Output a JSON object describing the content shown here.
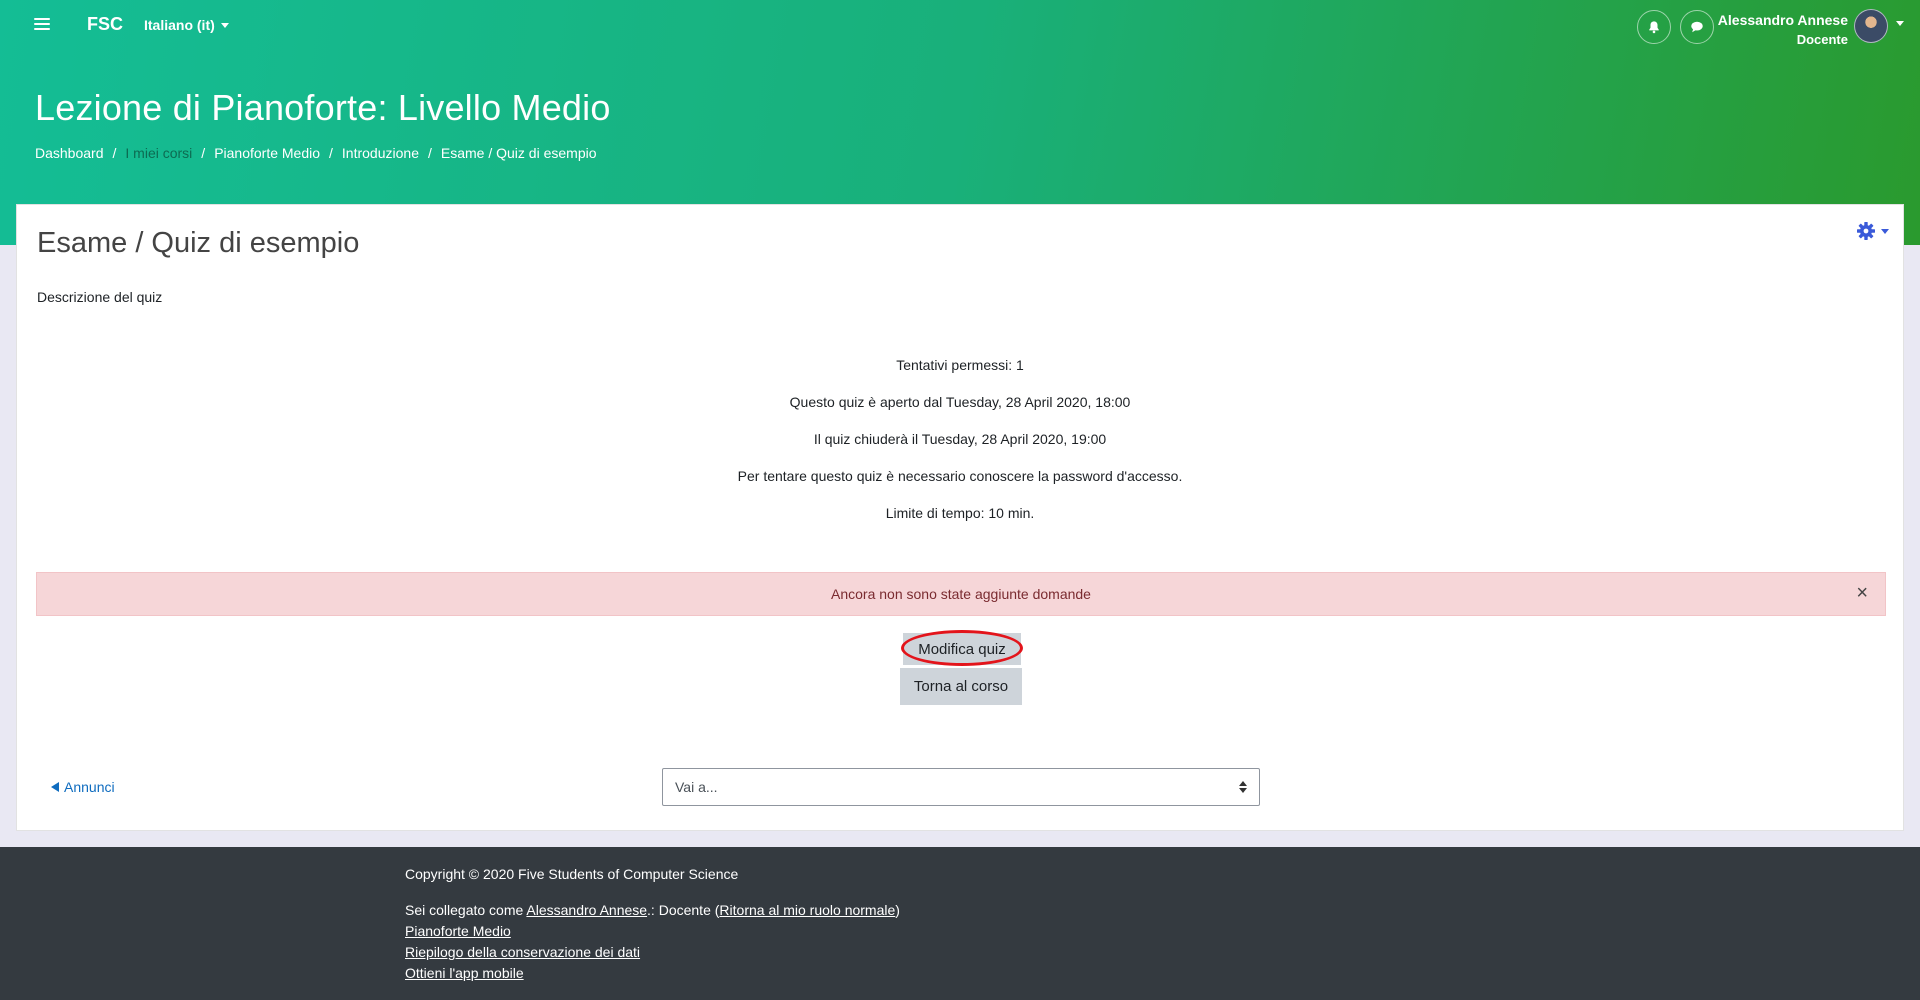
{
  "navbar": {
    "brand": "FSC",
    "language": "Italiano (it)",
    "user_name": "Alessandro Annese",
    "user_role": "Docente",
    "icons": [
      "bars-icon",
      "bell-icon",
      "chat-icon",
      "avatar",
      "chevron-down-icon"
    ]
  },
  "header": {
    "course_title": "Lezione di Pianoforte: Livello Medio",
    "breadcrumb": [
      "Dashboard",
      "I miei corsi",
      "Pianoforte Medio",
      "Introduzione",
      "Esame / Quiz di esempio"
    ],
    "breadcrumb_separator": "/"
  },
  "main": {
    "title": "Esame / Quiz di esempio",
    "description": "Descrizione del quiz",
    "info_lines": [
      "Tentativi permessi: 1",
      "Questo quiz è aperto dal Tuesday, 28 April 2020, 18:00",
      "Il quiz chiuderà il Tuesday, 28 April 2020, 19:00",
      "Per tentare questo quiz è necessario conoscere la password d'accesso.",
      "Limite di tempo: 10 min."
    ],
    "alert": "Ancora non sono state aggiunte domande",
    "alert_close": "×",
    "edit_button": "Modifica quiz",
    "back_button": "Torna al corso",
    "prev_link": "Annunci",
    "jump_placeholder": "Vai a..."
  },
  "footer": {
    "copyright": "Copyright © 2020 Five Students of Computer Science",
    "logged_prefix": "Sei collegato come ",
    "logged_user": "Alessandro Annese",
    "logged_middle": ".: Docente (",
    "return_role": "Ritorna al mio ruolo normale",
    "logged_suffix": ")",
    "links": [
      "Pianoforte Medio",
      "Riepilogo della conservazione dei dati",
      "Ottieni l'app mobile"
    ]
  },
  "colors": {
    "header_gradient_start": "#14bd95",
    "header_gradient_end": "#2a9a2e",
    "link": "#0f6cbf",
    "alert_bg": "#f6d6d8",
    "footer_bg": "#343a40",
    "annotation_red": "#e3141b"
  }
}
